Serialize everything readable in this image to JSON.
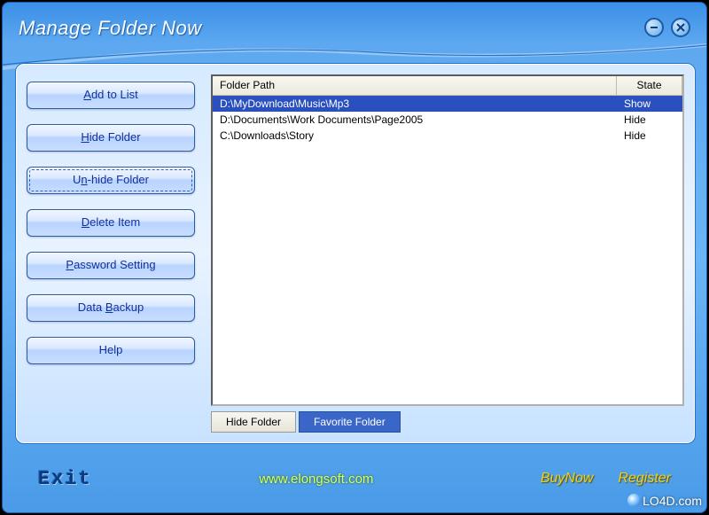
{
  "window": {
    "title": "Manage Folder Now"
  },
  "sidebar": {
    "buttons": [
      {
        "pre": "",
        "accel": "A",
        "post": "dd to List"
      },
      {
        "pre": "",
        "accel": "H",
        "post": "ide Folder"
      },
      {
        "pre": "U",
        "accel": "n",
        "post": "-hide Folder"
      },
      {
        "pre": "",
        "accel": "D",
        "post": "elete Item"
      },
      {
        "pre": "",
        "accel": "P",
        "post": "assword Setting"
      },
      {
        "pre": "Data ",
        "accel": "B",
        "post": "ackup"
      },
      {
        "pre": "Help",
        "accel": "",
        "post": ""
      }
    ]
  },
  "list": {
    "columns": {
      "path": "Folder Path",
      "state": "State"
    },
    "rows": [
      {
        "path": "D:\\MyDownload\\Music\\Mp3",
        "state": "Show",
        "selected": true
      },
      {
        "path": "D:\\Documents\\Work Documents\\Page2005",
        "state": "Hide",
        "selected": false
      },
      {
        "path": "C:\\Downloads\\Story",
        "state": "Hide",
        "selected": false
      }
    ]
  },
  "tabs": {
    "hide": "Hide Folder",
    "favorite": "Favorite Folder",
    "active": "favorite"
  },
  "footer": {
    "exit": "Exit",
    "url": "www.elongsoft.com",
    "buy": "BuyNow",
    "register": "Register"
  },
  "watermark": "LO4D.com"
}
